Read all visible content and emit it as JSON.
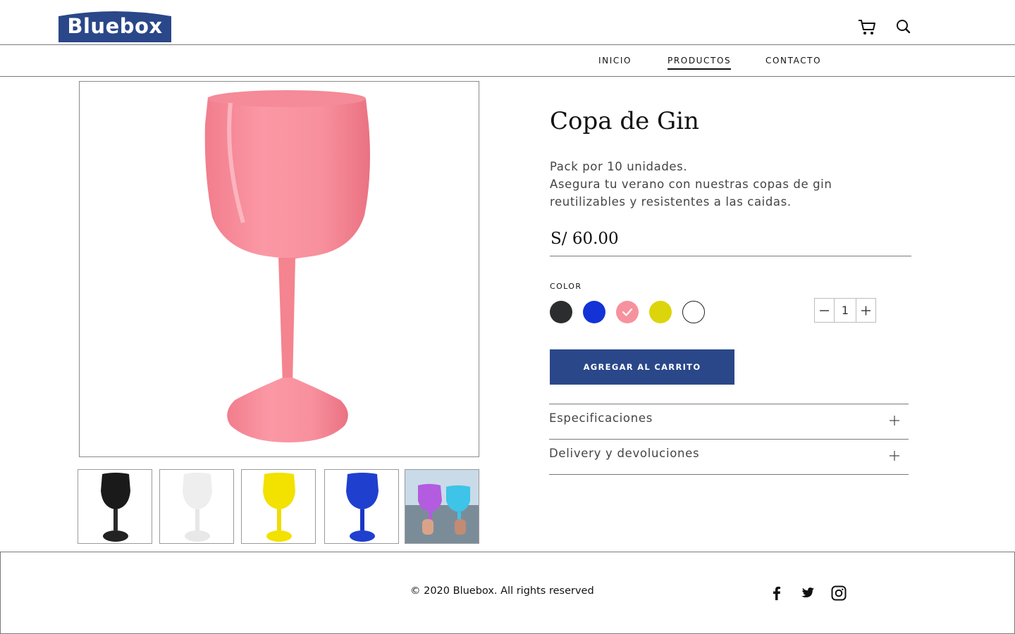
{
  "brand": {
    "name": "Bluebox",
    "color": "#2a4789"
  },
  "header": {
    "icons": [
      "cart-icon",
      "search-icon"
    ],
    "nav": [
      {
        "label": "INICIO",
        "active": false
      },
      {
        "label": "PRODUCTOS",
        "active": true
      },
      {
        "label": "CONTACTO",
        "active": false
      }
    ]
  },
  "gallery": {
    "main_color": "#f78b98",
    "thumbnails": [
      {
        "color": "#1a1a1a"
      },
      {
        "color": "#eeeeee"
      },
      {
        "color": "#f3e100"
      },
      {
        "color": "#1f3fcf"
      },
      {
        "color": "photo"
      }
    ]
  },
  "product": {
    "title": "Copa de Gin",
    "description": [
      "Pack por 10 unidades.",
      "Asegura tu verano con nuestras copas de gin",
      "reutilizables y resistentes a las caidas."
    ],
    "price": "S/ 60.00",
    "color_label": "COLOR",
    "colors": [
      {
        "name": "negro",
        "hex": "#2b2d2f",
        "selected": false
      },
      {
        "name": "azul",
        "hex": "#1433d6",
        "selected": false
      },
      {
        "name": "rosado",
        "hex": "#f7919e",
        "selected": true
      },
      {
        "name": "amarillo",
        "hex": "#dcd50c",
        "selected": false
      },
      {
        "name": "blanco",
        "hex": "#ffffff",
        "selected": false
      }
    ],
    "quantity": "1",
    "add_to_cart": "AGREGAR AL CARRITO",
    "accordions": [
      {
        "label": "Especificaciones"
      },
      {
        "label": "Delivery y devoluciones"
      }
    ]
  },
  "footer": {
    "copyright": "© 2020 Bluebox. All rights reserved",
    "social": [
      "facebook-icon",
      "twitter-icon",
      "instagram-icon"
    ]
  }
}
